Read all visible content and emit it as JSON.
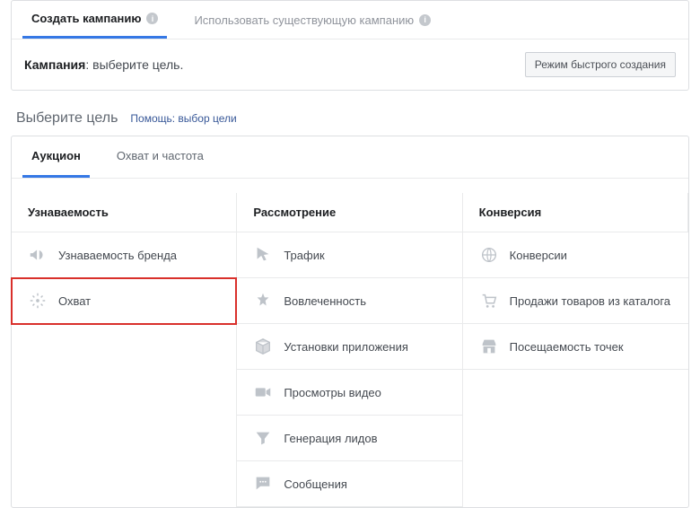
{
  "topTabs": {
    "create": "Создать кампанию",
    "existing": "Использовать существующую кампанию"
  },
  "campaign": {
    "label": "Кампания",
    "hint": "выберите цель.",
    "quickButton": "Режим быстрого создания"
  },
  "section": {
    "title": "Выберите цель",
    "helpLink": "Помощь: выбор цели"
  },
  "subTabs": {
    "auction": "Аукцион",
    "reachFreq": "Охват и частота"
  },
  "columns": {
    "awareness": "Узнаваемость",
    "consideration": "Рассмотрение",
    "conversion": "Конверсия"
  },
  "goals": {
    "awareness": [
      "Узнаваемость бренда",
      "Охват"
    ],
    "consideration": [
      "Трафик",
      "Вовлеченность",
      "Установки приложения",
      "Просмотры видео",
      "Генерация лидов",
      "Сообщения"
    ],
    "conversion": [
      "Конверсии",
      "Продажи товаров из каталога",
      "Посещаемость точек"
    ]
  }
}
